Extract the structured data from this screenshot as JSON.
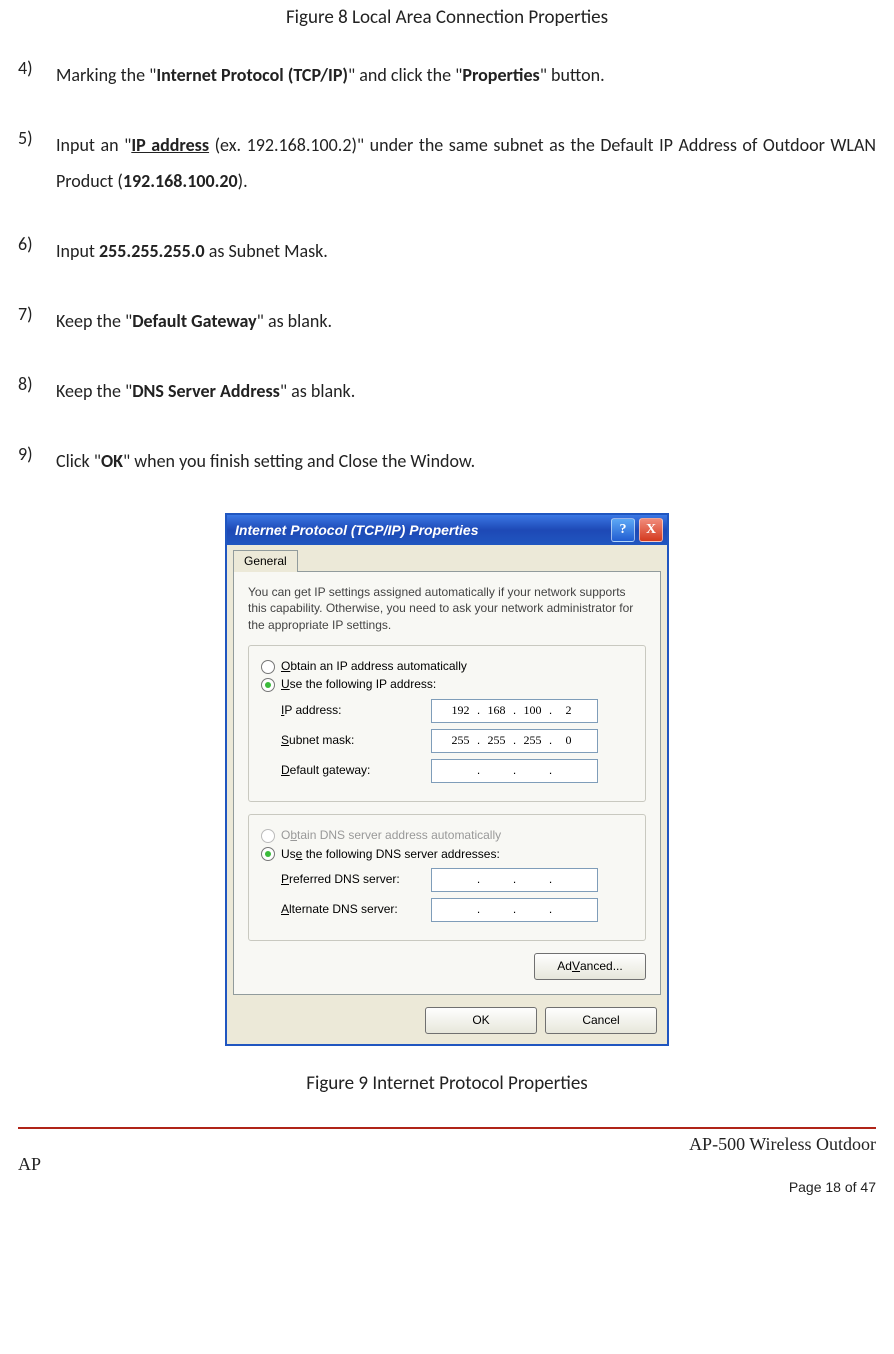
{
  "fig8_caption": "Figure 8    Local Area Connection Properties",
  "steps": {
    "s4": {
      "num": "4)",
      "pre": "Marking the \"",
      "bold": "Internet Protocol (TCP/IP)",
      "mid": "\" and click the \"",
      "bold2": "Properties",
      "post": "\" button."
    },
    "s5": {
      "num": "5)",
      "pre": "Input an \"",
      "bold": "IP address",
      "mid": " (ex. 192.168.100.2)\" under the same subnet as the Default IP Address of Outdoor WLAN Product (",
      "bold2": "192.168.100.20",
      "post": ")."
    },
    "s6": {
      "num": "6)",
      "pre": "Input ",
      "bold": "255.255.255.0",
      "post": " as Subnet Mask."
    },
    "s7": {
      "num": "7)",
      "pre": "Keep the \"",
      "bold": "Default Gateway",
      "post": "\" as blank."
    },
    "s8": {
      "num": "8)",
      "pre": "Keep the \"",
      "bold": "DNS Server Address",
      "post": "\" as blank."
    },
    "s9": {
      "num": "9)",
      "pre": "Click \"",
      "bold": "OK",
      "post": "\" when you finish setting and Close the Window."
    }
  },
  "dlg": {
    "title": "Internet Protocol (TCP/IP) Properties",
    "help": "?",
    "close": "X",
    "tab_general": "General",
    "intro": "You can get IP settings assigned automatically if your network supports this capability. Otherwise, you need to ask your network administrator for the appropriate IP settings.",
    "r_auto_ip_pre": "O",
    "r_auto_ip_txt": "btain an IP address automatically",
    "r_use_ip_pre": "U",
    "r_use_ip_txt": "se the following IP address:",
    "lbl_ip_pre": "I",
    "lbl_ip": "P address:",
    "lbl_sm_pre": "S",
    "lbl_sm": "ubnet mask:",
    "lbl_gw_pre": "D",
    "lbl_gw": "efault gateway:",
    "ip": [
      "192",
      "168",
      "100",
      "2"
    ],
    "sm": [
      "255",
      "255",
      "255",
      "0"
    ],
    "gw": [
      "",
      "",
      "",
      ""
    ],
    "r_auto_dns_pre": "b",
    "r_auto_dns_before": "O",
    "r_auto_dns_after": "tain DNS server address automatically",
    "r_use_dns_pre": "e",
    "r_use_dns_before": "Us",
    "r_use_dns_after": " the following DNS server addresses:",
    "lbl_pdns_pre": "P",
    "lbl_pdns": "referred DNS server:",
    "lbl_adns_pre": "A",
    "lbl_adns": "lternate DNS server:",
    "advanced_pre": "V",
    "advanced_before": "Ad",
    "advanced_after": "anced...",
    "ok": "OK",
    "cancel": "Cancel"
  },
  "fig9_caption": "Figure 9    Internet Protocol Properties",
  "footer": {
    "product": "AP-500    Wireless  Outdoor",
    "ap": "AP",
    "page": "Page 18 of 47"
  }
}
